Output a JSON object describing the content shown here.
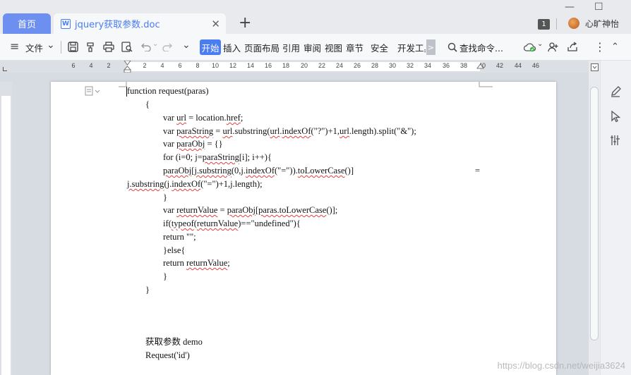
{
  "tabs": {
    "home_label": "首页",
    "doc_label": "jquery获取参数.doc",
    "doc_icon_letter": "W",
    "close_glyph": "✕",
    "add_glyph": "+"
  },
  "window": {
    "badge_count": "1",
    "username": "心旷神怡",
    "minimize": "—",
    "maximize": "☐"
  },
  "toolbar": {
    "menu_icon": "≡",
    "file_label": "文件",
    "dropdown_glyph": "⌄",
    "start_label": "开始",
    "insert_label": "插入",
    "page_layout_label": "页面布局",
    "references_label": "引用",
    "review_label": "审阅",
    "view_label": "视图",
    "chapter_label": "章节",
    "security_label": "安全",
    "dev_tools_label": "开发工具",
    "more_glyph": ">",
    "search_placeholder": "查找命令...",
    "kebab": "⋮",
    "collapse": "⌃"
  },
  "ruler": {
    "left_numbers": [
      "6",
      "4",
      "2"
    ],
    "right_numbers": [
      "2",
      "4",
      "6",
      "8",
      "10",
      "12",
      "14",
      "16",
      "18",
      "20",
      "22",
      "24",
      "26",
      "28",
      "30",
      "32",
      "34",
      "36",
      "38",
      "40",
      "42",
      "44",
      "46"
    ]
  },
  "document": {
    "lines": [
      "function request(paras)",
      "{",
      "var url = location.href;",
      "var paraString = url.substring(url.indexOf(\"?\")+1,url.length).split(\"&\");",
      "var paraObj = {}",
      "for (i=0; j=paraString[i]; i++){",
      "paraObj[j.substring(0,j.indexOf(\"=\")).toLowerCase()]",
      "=",
      "j.substring(j.indexOf(\"=\")+1,j.length);",
      "}",
      "var returnValue = paraObj[paras.toLowerCase()];",
      "if(typeof(returnValue)==\"undefined\"){",
      "return \"\";",
      "}else{",
      "return returnValue;",
      "}",
      "}",
      "获取参数 demo",
      "Request('id')"
    ]
  },
  "watermark": "https://blog.csdn.net/weijia3624"
}
